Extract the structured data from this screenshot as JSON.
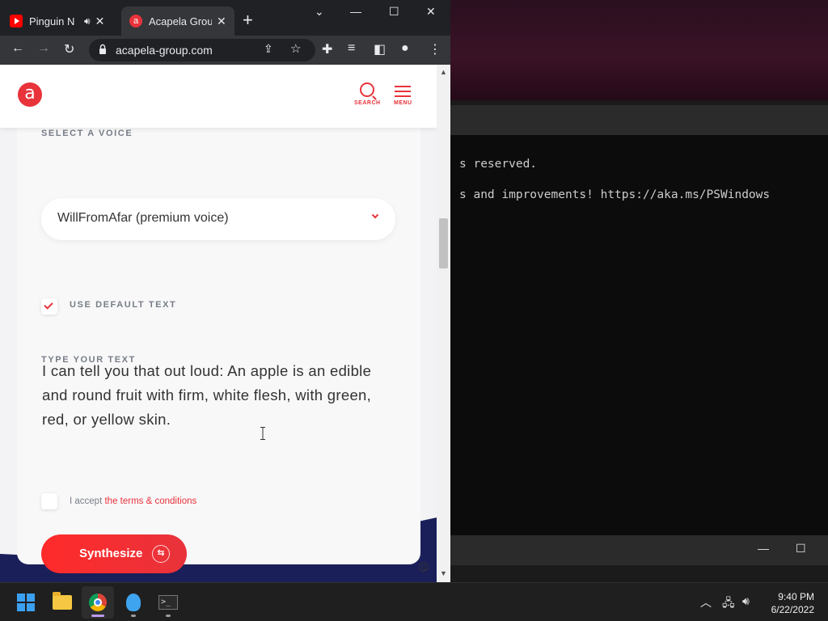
{
  "browser": {
    "tabs": [
      {
        "title": "Pinguin N",
        "favicon": "youtube-icon",
        "audio": true
      },
      {
        "title": "Acapela Group",
        "favicon": "acapela-icon",
        "active": true
      }
    ],
    "url": "acapela-group.com"
  },
  "site": {
    "logo_letter": "a",
    "search_label": "SEARCH",
    "menu_label": "MENU",
    "select_voice_label": "SELECT A VOICE",
    "voice_value": "WillFromAfar (premium voice)",
    "use_default_label": "USE DEFAULT TEXT",
    "use_default_checked": true,
    "type_text_label": "TYPE YOUR TEXT",
    "text_value": "I can tell you that out loud: An apple is an edible and round fruit with firm, white flesh, with green, red, or yellow skin.",
    "accept_prefix": "I accept",
    "accept_link": "the terms & conditions",
    "synthesize_label": "Synthesize"
  },
  "terminal": {
    "line1": "s reserved.",
    "line2": "s and improvements! https://aka.ms/PSWindows"
  },
  "taskbar": {
    "time": "9:40 PM",
    "date": "6/22/2022"
  },
  "colors": {
    "accent": "#e8333b",
    "browser_frame": "#202124",
    "taskbar": "#1f1f1f"
  }
}
